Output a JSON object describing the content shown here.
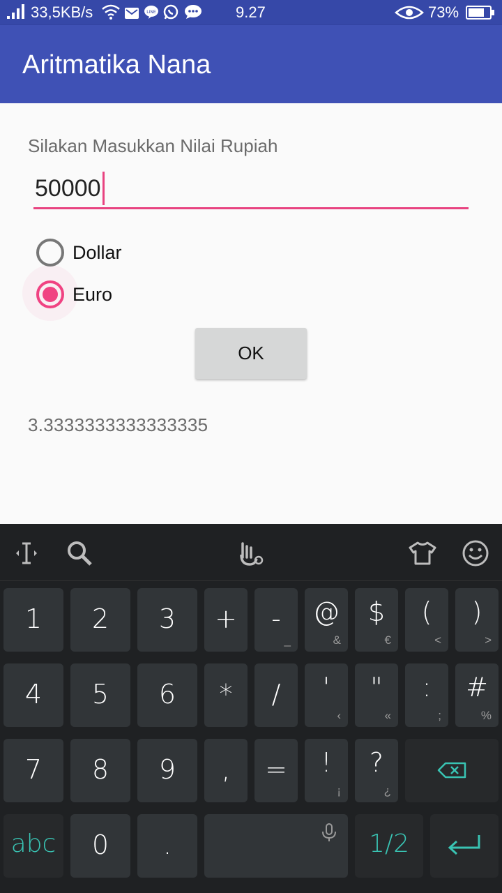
{
  "status_bar": {
    "network_speed": "33,5KB/s",
    "time": "9.27",
    "battery": "73%"
  },
  "app_bar": {
    "title": "Aritmatika Nana"
  },
  "form": {
    "prompt": "Silakan Masukkan Nilai Rupiah",
    "rupiah_value": "50000",
    "options": [
      {
        "label": "Dollar",
        "selected": false
      },
      {
        "label": "Euro",
        "selected": true
      }
    ],
    "ok_label": "OK",
    "result": "3.3333333333333335"
  },
  "keyboard": {
    "row1": [
      {
        "main": "1",
        "alt": ""
      },
      {
        "main": "2",
        "alt": ""
      },
      {
        "main": "3",
        "alt": ""
      },
      {
        "main": "+",
        "alt": ""
      },
      {
        "main": "-",
        "alt": "_"
      },
      {
        "main": "@",
        "alt": "&"
      },
      {
        "main": "$",
        "alt": "€"
      },
      {
        "main": "(",
        "alt": "<"
      },
      {
        "main": ")",
        "alt": ">"
      }
    ],
    "row2": [
      {
        "main": "4",
        "alt": ""
      },
      {
        "main": "5",
        "alt": ""
      },
      {
        "main": "6",
        "alt": ""
      },
      {
        "main": "*",
        "alt": ""
      },
      {
        "main": "/",
        "alt": ""
      },
      {
        "main": "'",
        "alt": "‹"
      },
      {
        "main": "\"",
        "alt": "«"
      },
      {
        "main": ":",
        "alt": ";"
      },
      {
        "main": "#",
        "alt": "%"
      }
    ],
    "row3": [
      {
        "main": "7",
        "alt": ""
      },
      {
        "main": "8",
        "alt": ""
      },
      {
        "main": "9",
        "alt": ""
      },
      {
        "main": ",",
        "alt": ""
      },
      {
        "main": "=",
        "alt": ""
      },
      {
        "main": "!",
        "alt": "¡"
      },
      {
        "main": "?",
        "alt": "¿"
      }
    ],
    "abc_label": "abc",
    "zero_label": "0",
    "dot_label": ".",
    "page_label": "1/2",
    "accent_color": "#39c3b3"
  }
}
